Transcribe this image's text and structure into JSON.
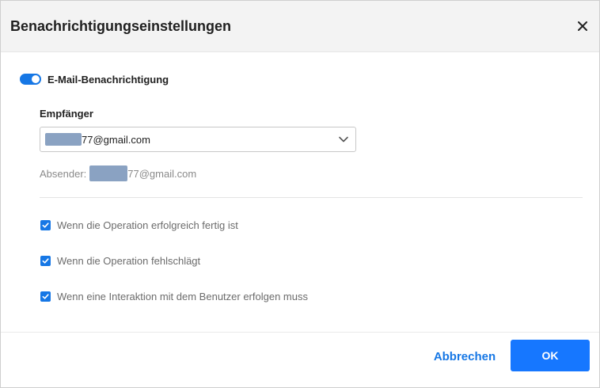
{
  "dialog": {
    "title": "Benachrichtigungseinstellungen",
    "close_icon": "close-icon"
  },
  "email_notification": {
    "label": "E-Mail-Benachrichtigung",
    "enabled": true,
    "accent_color": "#1677e5"
  },
  "recipient": {
    "label": "Empfänger",
    "value_suffix": "77@gmail.com",
    "dropdown_icon": "chevron-down-icon"
  },
  "sender": {
    "label": "Absender:",
    "value_suffix": "77@gmail.com"
  },
  "options": [
    {
      "label": "Wenn die Operation erfolgreich fertig ist",
      "checked": true
    },
    {
      "label": "Wenn die Operation fehlschlägt",
      "checked": true
    },
    {
      "label": "Wenn eine Interaktion mit dem Benutzer erfolgen muss",
      "checked": true
    }
  ],
  "footer": {
    "cancel_label": "Abbrechen",
    "ok_label": "OK",
    "primary_color": "#1677ff"
  }
}
